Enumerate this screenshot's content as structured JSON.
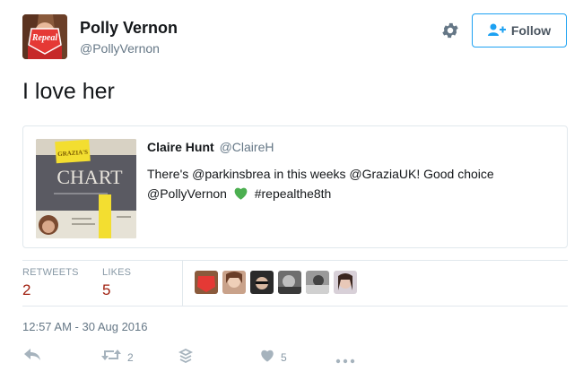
{
  "author": {
    "name": "Polly Vernon",
    "handle": "@PollyVernon",
    "avatar_text": "Repeal"
  },
  "header": {
    "settings_icon": "gear-icon",
    "follow_label": "Follow",
    "follow_icon": "person-plus-icon"
  },
  "tweet": {
    "text": "I love her"
  },
  "quote": {
    "name": "Claire Hunt",
    "handle": "@ClaireH",
    "text_before": "There's @parkinsbrea in this weeks @GraziaUK! Good choice @PollyVernon",
    "heart_color": "#4caf50",
    "text_after": "#repealthe8th",
    "image_text_1": "GRAZIA'S",
    "image_text_2": "CHART"
  },
  "stats": {
    "retweets_label": "RETWEETS",
    "retweets_count": "2",
    "likes_label": "LIKES",
    "likes_count": "5",
    "count_color": "#a02010"
  },
  "timestamp": "12:57 AM - 30 Aug 2016",
  "actions": {
    "reply_icon": "reply-icon",
    "retweet_icon": "retweet-icon",
    "retweet_count": "2",
    "layers_icon": "layers-icon",
    "like_icon": "heart-icon",
    "like_count": "5",
    "more_icon": "more-icon"
  },
  "colors": {
    "accent": "#1da1f2",
    "muted": "#8899a6",
    "border": "#e1e8ed"
  }
}
